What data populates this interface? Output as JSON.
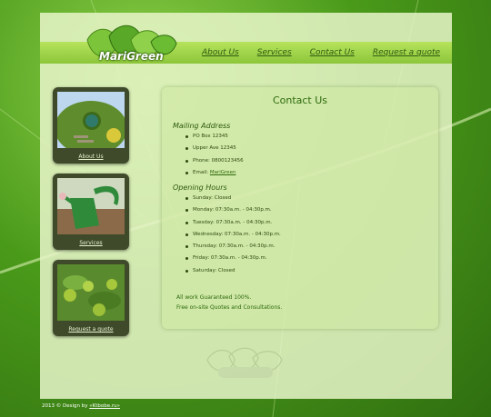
{
  "logo": {
    "text": "MariGreen"
  },
  "nav": [
    {
      "label": "About Us"
    },
    {
      "label": "Services"
    },
    {
      "label": "Contact Us"
    },
    {
      "label": "Request a quote"
    }
  ],
  "sidebar": [
    {
      "caption": "About Us"
    },
    {
      "caption": "Services"
    },
    {
      "caption": "Request a quote"
    }
  ],
  "content": {
    "title": "Contact Us",
    "mailing_title": "Mailing Address",
    "mailing": [
      "PO Box 12345",
      "Upper Ave 12345",
      "Phone: 0800123456"
    ],
    "email_prefix": "Email: ",
    "email_link": "MariGreen",
    "hours_title": "Opening Hours",
    "hours": [
      "Sunday: Closed",
      "Monday: 07:30a.m. - 04:30p.m.",
      "Tuesday: 07:30a.m. - 04:30p.m.",
      "Wednesday: 07:30a.m. - 04:30p.m.",
      "Thursday: 07:30a.m. - 04:30p.m.",
      "Friday: 07:30a.m. - 04:30p.m.",
      "Saturday: Closed"
    ],
    "note_line1": "All work Guaranteed 100%.",
    "note_line2": "Free on-site Quotes and Consultations."
  },
  "footer": {
    "prefix": "2013 © Design by ",
    "link": "«Ktbobe.ru»"
  },
  "colors": {
    "accent": "#2d6a0c",
    "band": "#8cc63a",
    "card": "#3e4a2a"
  }
}
